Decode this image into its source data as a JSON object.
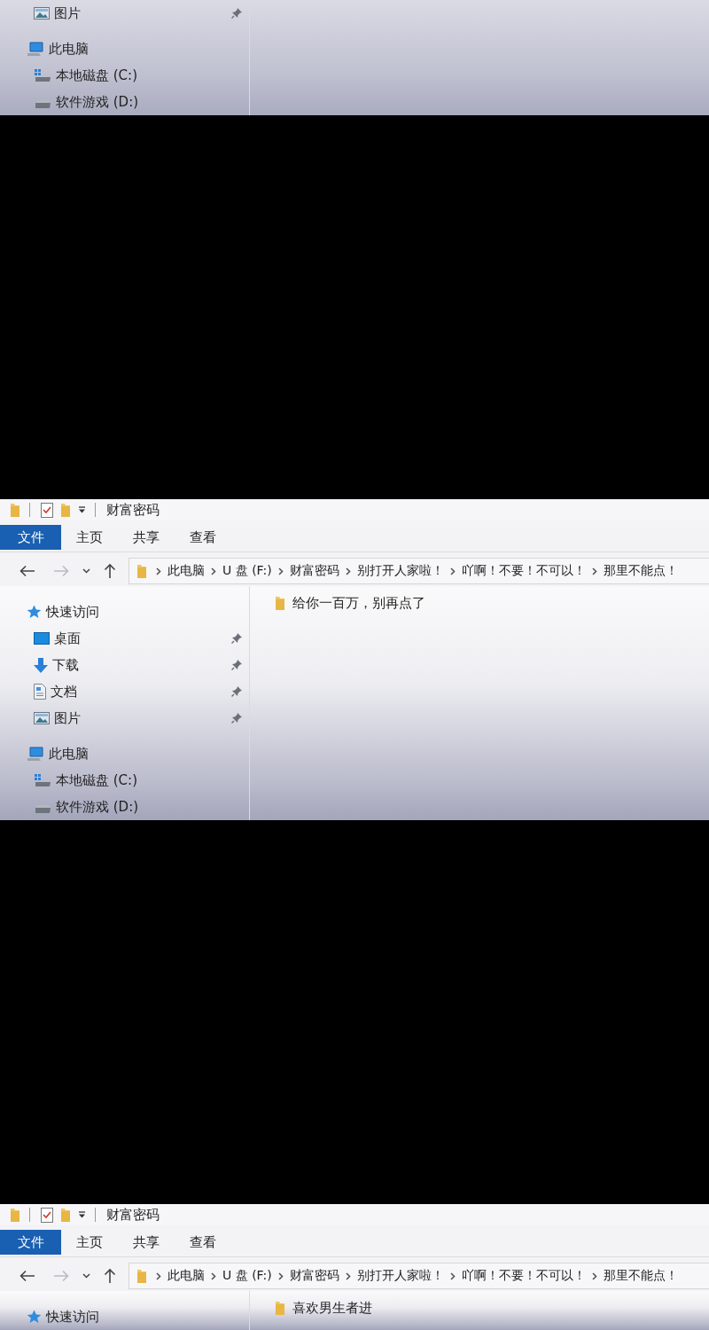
{
  "panels": [
    {
      "sidebar": [
        {
          "children": [
            {
              "label": "图片",
              "kind": "pictures",
              "pinned": true
            }
          ]
        },
        {
          "label": "此电脑",
          "kind": "this-pc",
          "pinned": false,
          "children": [
            {
              "label": "本地磁盘 (C:)",
              "kind": "system-drive",
              "pinned": false
            },
            {
              "label": "软件游戏 (D:)",
              "kind": "drive",
              "pinned": false
            }
          ]
        }
      ]
    },
    {
      "title": "财富密码",
      "tabs": [
        {
          "label": "文件",
          "selected": true
        },
        {
          "label": "主页",
          "selected": false
        },
        {
          "label": "共享",
          "selected": false
        },
        {
          "label": "查看",
          "selected": false
        }
      ],
      "nav": [
        {
          "kind": "back",
          "disabled": false
        },
        {
          "kind": "forward",
          "disabled": true
        },
        {
          "kind": "recent",
          "disabled": false
        },
        {
          "kind": "up",
          "disabled": false
        }
      ],
      "address": [
        "此电脑",
        "U 盘 (F:)",
        "财富密码",
        "别打开人家啦！",
        "吖啊！不要！不可以！",
        "那里不能点！"
      ],
      "sidebar": [
        {
          "label": "快速访问",
          "kind": "quick-access",
          "pinned": false,
          "children": [
            {
              "label": "桌面",
              "kind": "desktop",
              "pinned": true
            },
            {
              "label": "下载",
              "kind": "downloads",
              "pinned": true
            },
            {
              "label": "文档",
              "kind": "documents",
              "pinned": true
            },
            {
              "label": "图片",
              "kind": "pictures",
              "pinned": true
            }
          ]
        },
        {
          "label": "此电脑",
          "kind": "this-pc",
          "pinned": false,
          "children": [
            {
              "label": "本地磁盘 (C:)",
              "kind": "system-drive",
              "pinned": false
            },
            {
              "label": "软件游戏 (D:)",
              "kind": "drive",
              "pinned": false
            }
          ]
        }
      ],
      "files": [
        {
          "name": "给你一百万，别再点了",
          "kind": "folder"
        }
      ]
    },
    {
      "title": "财富密码",
      "tabs": [
        {
          "label": "文件",
          "selected": true
        },
        {
          "label": "主页",
          "selected": false
        },
        {
          "label": "共享",
          "selected": false
        },
        {
          "label": "查看",
          "selected": false
        }
      ],
      "nav": [
        {
          "kind": "back",
          "disabled": false
        },
        {
          "kind": "forward",
          "disabled": true
        },
        {
          "kind": "recent",
          "disabled": false
        },
        {
          "kind": "up",
          "disabled": false
        }
      ],
      "address": [
        "此电脑",
        "U 盘 (F:)",
        "财富密码",
        "别打开人家啦！",
        "吖啊！不要！不可以！",
        "那里不能点！"
      ],
      "sidebar": [
        {
          "label": "快速访问",
          "kind": "quick-access",
          "pinned": false
        }
      ],
      "files": [
        {
          "name": "喜欢男生者进",
          "kind": "folder"
        }
      ]
    }
  ]
}
